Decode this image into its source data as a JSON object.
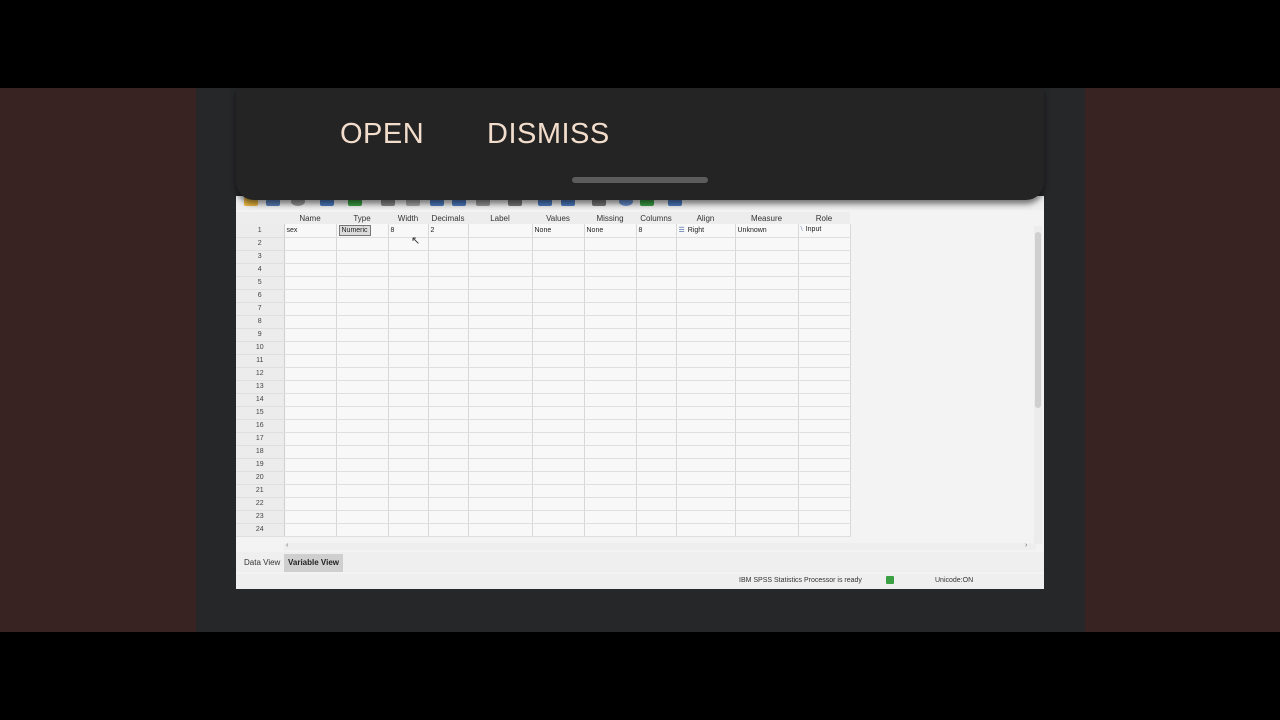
{
  "notification": {
    "open_label": "OPEN",
    "dismiss_label": "DISMISS"
  },
  "grid": {
    "columns": [
      "",
      "Name",
      "Type",
      "Width",
      "Decimals",
      "Label",
      "Values",
      "Missing",
      "Columns",
      "Align",
      "Measure",
      "Role"
    ],
    "row1": {
      "num": "1",
      "name": "sex",
      "type": "Numeric",
      "width": "8",
      "decimals": "2",
      "label": "",
      "values": "None",
      "missing": "None",
      "columns": "8",
      "align": "Right",
      "measure": "Unknown",
      "role": "Input"
    },
    "row_numbers": [
      "2",
      "3",
      "4",
      "5",
      "6",
      "7",
      "8",
      "9",
      "10",
      "11",
      "12",
      "13",
      "14",
      "15",
      "16",
      "17",
      "18",
      "19",
      "20",
      "21",
      "22",
      "23",
      "24"
    ]
  },
  "tabs": {
    "data_view": "Data View",
    "variable_view": "Variable View"
  },
  "status": {
    "processor": "IBM SPSS Statistics Processor is ready",
    "unicode": "Unicode:ON"
  },
  "icons": [
    "align-right-icon",
    "input-role-icon",
    "processor-ready-icon",
    "mouse-cursor-icon"
  ]
}
